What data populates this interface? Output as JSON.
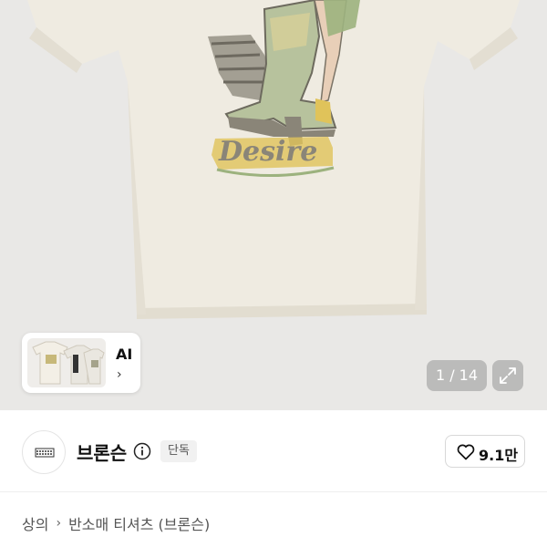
{
  "product_image": {
    "artwork_text": "Desire",
    "colors": {
      "background": "#e9e8e6",
      "shirt": "#efebe1",
      "print_gray": "#8a8578",
      "print_yellow": "#e0c35a",
      "print_green": "#9cb27e"
    }
  },
  "ai_card": {
    "label": "AI",
    "chevron": "›"
  },
  "gallery": {
    "counter": "1 / 14",
    "current": 1,
    "total": 14,
    "expand_icon": "expand-icon"
  },
  "brand": {
    "name": "브론슨",
    "badge": "단독",
    "info_icon": "info-icon"
  },
  "like": {
    "count": "9.1만",
    "icon": "heart-icon"
  },
  "breadcrumb": {
    "items": [
      "상의",
      "반소매 티셔츠 (브론슨)"
    ],
    "separator": "›"
  }
}
